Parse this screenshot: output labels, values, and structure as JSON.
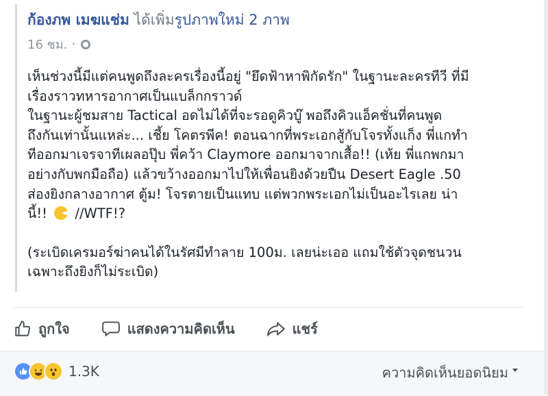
{
  "post": {
    "author": "ก้องภพ เมฆแช่ม",
    "action_text": "ได้เพิ่ม",
    "photos_link": "รูปภาพใหม่ 2 ภาพ",
    "timestamp": "16 ชม.",
    "separator": "·",
    "privacy_icon": "globe-icon",
    "paragraph1": [
      "เห็นช่วงนี้มีแต่คนพูดถึงละครเรื่องนี้อยู่ \"ยึดฟ้าหาพิกัดรัก\" ในฐานะละครทีวี ที่มี",
      "เรื่องราวทหารอากาศเป็นแบล็กกราวด์",
      "ในฐานะผู้ชมสาย Tactical อดไม่ได้ที่จะรอดูคิวบู๊ พอถึงคิวแอ็คชั่นที่คนพูด",
      "ถึงกันเท่านั้นแหล่ะ... เชี้ย โคตรพีค! ตอนฉากที่พระเอกสู้กับโจรทั้งแก็ง พี่แกทำ",
      "ทีออกมาเจรจาทีเผลอปุ๊บ พี่คว้า Claymore ออกมาจากเสื้อ!! (เห้ย พี่แกพกมา",
      "อย่างกับพกมือถือ) แล้วขว้างออกมาไปให้เพื่อนยิงด้วยปืน Desert Eagle .50",
      "ส่องยิงกลางอากาศ ตู้ม! โจรตายเป็นแทบ แต่พวกพระเอกไม่เป็นอะไรเลย น่า"
    ],
    "paragraph1_last_prefix": "นี้!!",
    "paragraph1_last_suffix": "//WTF!?",
    "paragraph2": [
      "(ระเบิดเครมอร์ฆ่าคนได้ในรัศมีทำลาย 100ม. เลยน่ะเออ แถมใช้ตัวจุดชนวน",
      "เฉพาะถึงยิงก็ไม่ระเบิด)"
    ]
  },
  "actions": {
    "like": "ถูกใจ",
    "comment": "แสดงความคิดเห็น",
    "share": "แชร์"
  },
  "footer": {
    "reaction_count": "1.3K",
    "sort_label": "ความคิดเห็นยอดนิยม"
  },
  "colors": {
    "link": "#365899",
    "secondary": "#90949c",
    "like_blue": "#5890ff",
    "emoji_yellow": "#f7c531"
  }
}
